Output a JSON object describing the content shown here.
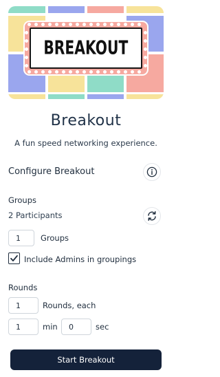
{
  "banner": {
    "marquee_text": "BREAKOUT"
  },
  "header": {
    "title": "Breakout",
    "subtitle": "A fun speed networking experience."
  },
  "configure": {
    "title": "Configure Breakout",
    "info_icon": "info-icon"
  },
  "groups": {
    "title": "Groups",
    "participants": "2 Participants",
    "refresh_icon": "refresh-icon",
    "count_value": "1",
    "count_label": "Groups",
    "include_admins_label": "Include Admins in groupings",
    "include_admins_checked": true
  },
  "rounds": {
    "title": "Rounds",
    "count_value": "1",
    "count_label": "Rounds, each",
    "min_value": "1",
    "min_label": "min",
    "sec_value": "0",
    "sec_label": "sec"
  },
  "actions": {
    "start_label": "Start Breakout"
  },
  "colors": {
    "navy": "#14223a",
    "teal": "#8fdcc7",
    "blue": "#9aa6ee",
    "pink": "#f6a9a0",
    "yellow": "#f7e39a"
  }
}
